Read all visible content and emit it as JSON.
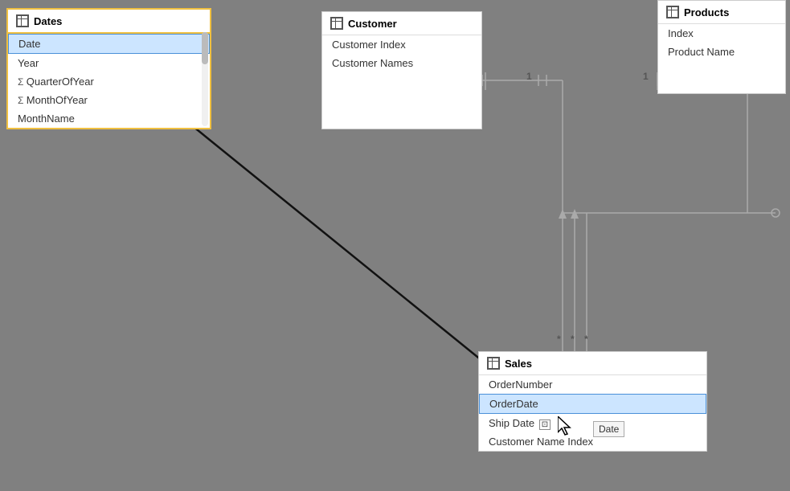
{
  "dates_table": {
    "title": "Dates",
    "rows": [
      {
        "label": "Date",
        "type": "normal",
        "selected": true
      },
      {
        "label": "Year",
        "type": "normal"
      },
      {
        "label": "QuarterOfYear",
        "type": "sigma"
      },
      {
        "label": "MonthOfYear",
        "type": "sigma"
      },
      {
        "label": "MonthName",
        "type": "normal"
      }
    ]
  },
  "customer_table": {
    "title": "Customer",
    "rows": [
      {
        "label": "Customer Index"
      },
      {
        "label": "Customer Names"
      }
    ]
  },
  "products_table": {
    "title": "Products",
    "rows": [
      {
        "label": "Index"
      },
      {
        "label": "Product Name"
      }
    ]
  },
  "sales_table": {
    "title": "Sales",
    "rows": [
      {
        "label": "OrderNumber"
      },
      {
        "label": "OrderDate",
        "selected": true
      },
      {
        "label": "Ship Date",
        "has_icon": true
      },
      {
        "label": "Customer Name Index"
      }
    ]
  },
  "tooltip": "Date",
  "relation_labels": {
    "one_left": "1",
    "one_right": "1",
    "many_stars": [
      "*",
      "*",
      "*"
    ]
  }
}
